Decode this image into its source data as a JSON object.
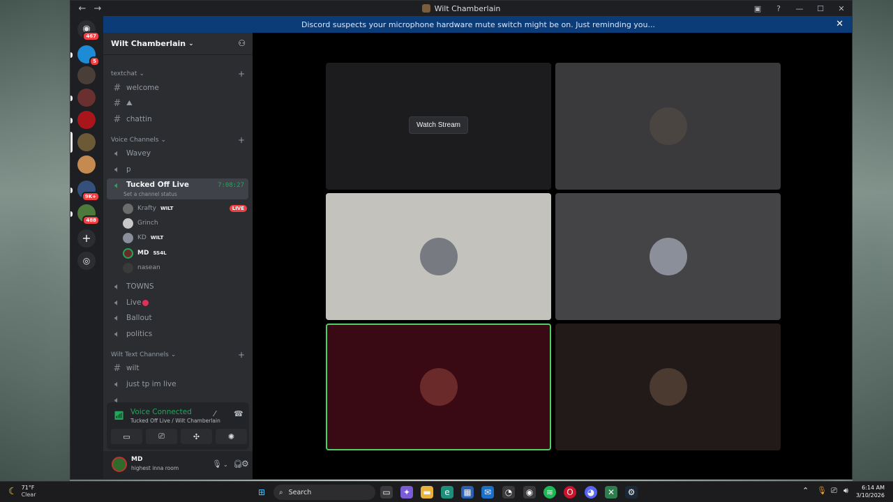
{
  "window": {
    "title": "Wilt Chamberlain",
    "back_icon": "←",
    "forward_icon": "→"
  },
  "notice": {
    "text": "Discord suspects your microphone hardware mute switch might be on. Just reminding you...",
    "close": "✕"
  },
  "rail": {
    "badges": [
      "467",
      "5",
      "9K+",
      "488"
    ]
  },
  "server": {
    "name": "Wilt Chamberlain",
    "chevron": "⌄"
  },
  "channels": {
    "categories": {
      "textchat": "textchat",
      "voice": "Voice Channels",
      "wilt_text": "Wilt Text Channels"
    },
    "text1": [
      "welcome",
      "",
      "chattin"
    ],
    "voice": [
      "Wavey",
      "p"
    ],
    "active": {
      "name": "Tucked Off Live",
      "timer": "7:08:27",
      "status": "Set a channel status"
    },
    "members": [
      {
        "name": "Krafty",
        "tag": "WILT",
        "live": "LIVE"
      },
      {
        "name": "Grinch",
        "tag": "",
        "live": ""
      },
      {
        "name": "KD",
        "tag": "WILT",
        "live": ""
      },
      {
        "name": "MD",
        "tag": "SS4L",
        "live": ""
      },
      {
        "name": "nasean",
        "tag": "",
        "live": ""
      }
    ],
    "voice2": [
      "TOWNS",
      "Live",
      "Ballout",
      "politics"
    ],
    "wilt_text": [
      "wilt",
      "just tp im live"
    ]
  },
  "voice_panel": {
    "title": "Voice Connected",
    "subtitle": "Tucked Off Live / Wilt Chamberlain"
  },
  "user": {
    "name": "MD",
    "status": "highest inna room"
  },
  "video": {
    "watch_stream": "Watch Stream",
    "tile_colors": [
      "#1c1c1e",
      "#3a3a3c",
      "#c4c2bd",
      "#444446",
      "#3a0a14",
      "#211a18"
    ]
  },
  "taskbar": {
    "temp": "71°F",
    "condition": "Clear",
    "search_placeholder": "Search",
    "time": "6:14 AM",
    "date": "3/10/2026"
  }
}
